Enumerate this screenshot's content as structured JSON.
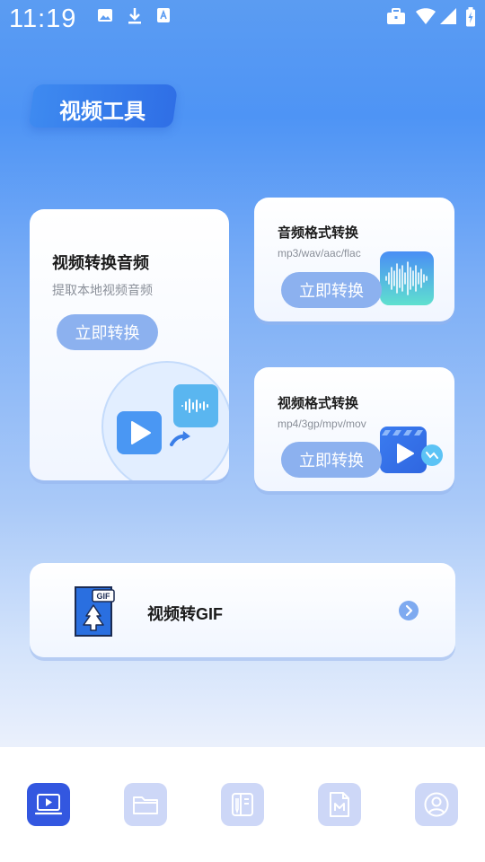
{
  "status_bar": {
    "time": "11:19",
    "left_icons": [
      "image-icon",
      "download-icon",
      "translate-icon"
    ],
    "right_icons": [
      "briefcase-icon",
      "wifi-icon",
      "signal-icon",
      "battery-icon"
    ]
  },
  "header": {
    "title": "视频工具"
  },
  "cards": {
    "video_to_audio": {
      "title": "视频转换音频",
      "subtitle": "提取本地视频音频",
      "button": "立即转换"
    },
    "audio_format": {
      "title": "音频格式转换",
      "formats": "mp3/wav/aac/flac",
      "button": "立即转换"
    },
    "video_format": {
      "title": "视频格式转换",
      "formats": "mp4/3gp/mpv/mov",
      "button": "立即转换"
    },
    "video_to_gif": {
      "title": "视频转GIF",
      "icon_badge": "GIF"
    }
  },
  "bottom_nav": {
    "items": [
      {
        "icon": "video-tool-icon",
        "active": true
      },
      {
        "icon": "folder-icon",
        "active": false
      },
      {
        "icon": "notes-icon",
        "active": false
      },
      {
        "icon": "document-icon",
        "active": false
      },
      {
        "icon": "profile-icon",
        "active": false
      }
    ]
  },
  "colors": {
    "accent": "#3357e0",
    "button": "#8cb1ef",
    "nav_inactive": "#cdd7f7",
    "title_badge": "#3e8af0"
  }
}
